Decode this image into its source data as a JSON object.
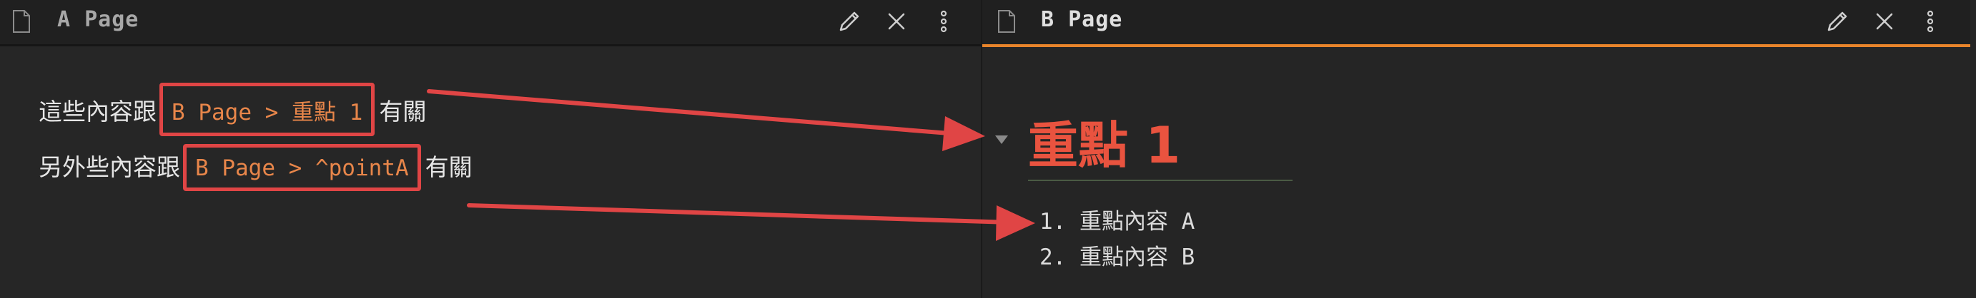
{
  "left_pane": {
    "title": "A Page",
    "line1": {
      "before": "這些內容跟",
      "link": "B Page > 重點 1",
      "after": "有關"
    },
    "line2": {
      "before": "另外些內容跟",
      "link": "B Page > ^pointA",
      "after": "有關"
    }
  },
  "right_pane": {
    "title": "B Page",
    "heading": "重點 1",
    "list_items": [
      "1. 重點內容 A",
      "2. 重點內容 B"
    ]
  },
  "icons": {
    "file": "file-icon",
    "edit": "pencil-icon",
    "close": "close-icon",
    "more": "more-vertical-icon",
    "collapse": "caret-down-icon"
  },
  "colors": {
    "accent_tab": "#e8842b",
    "link_text": "#e8864a",
    "heading": "#e9533f",
    "annotation_red": "#e04545"
  }
}
